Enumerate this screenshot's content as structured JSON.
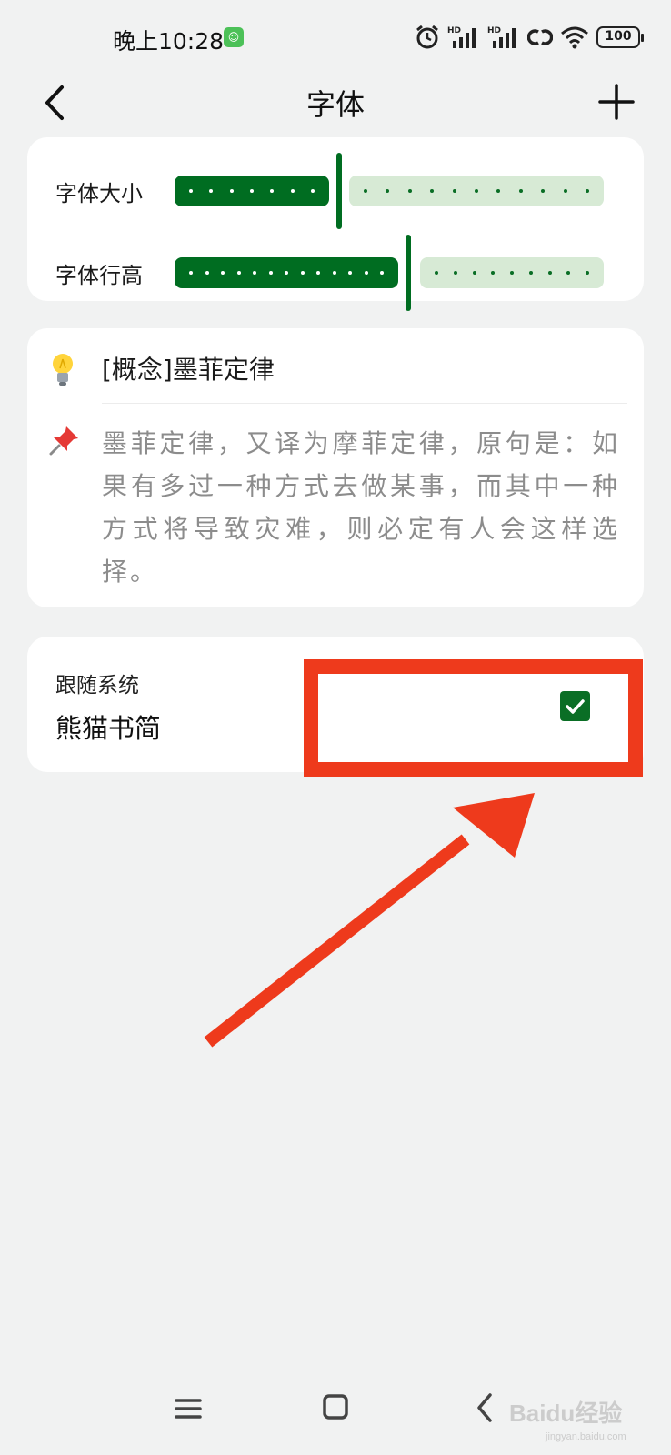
{
  "status_bar": {
    "time": "晚上10:28",
    "battery": "100",
    "hd_label": "HD"
  },
  "header": {
    "title": "字体"
  },
  "sliders": [
    {
      "label": "字体大小",
      "value_fraction": 0.36
    },
    {
      "label": "字体行高",
      "value_fraction": 0.54
    }
  ],
  "preview": {
    "title": "[概念]墨菲定律",
    "body": "墨菲定律，又译为摩菲定律，原句是：如果有多过一种方式去做某事，而其中一种方式将导致灾难，则必定有人会这样选择。"
  },
  "font_option": {
    "sublabel": "跟随系统",
    "name": "熊猫书简",
    "selected": true
  },
  "colors": {
    "accent": "#006d21",
    "track_empty": "#d7ead5",
    "annotation": "#ee3a1c",
    "background": "#f1f2f2"
  },
  "watermark": {
    "main": "Baidu经验",
    "sub": "jingyan.baidu.com"
  }
}
